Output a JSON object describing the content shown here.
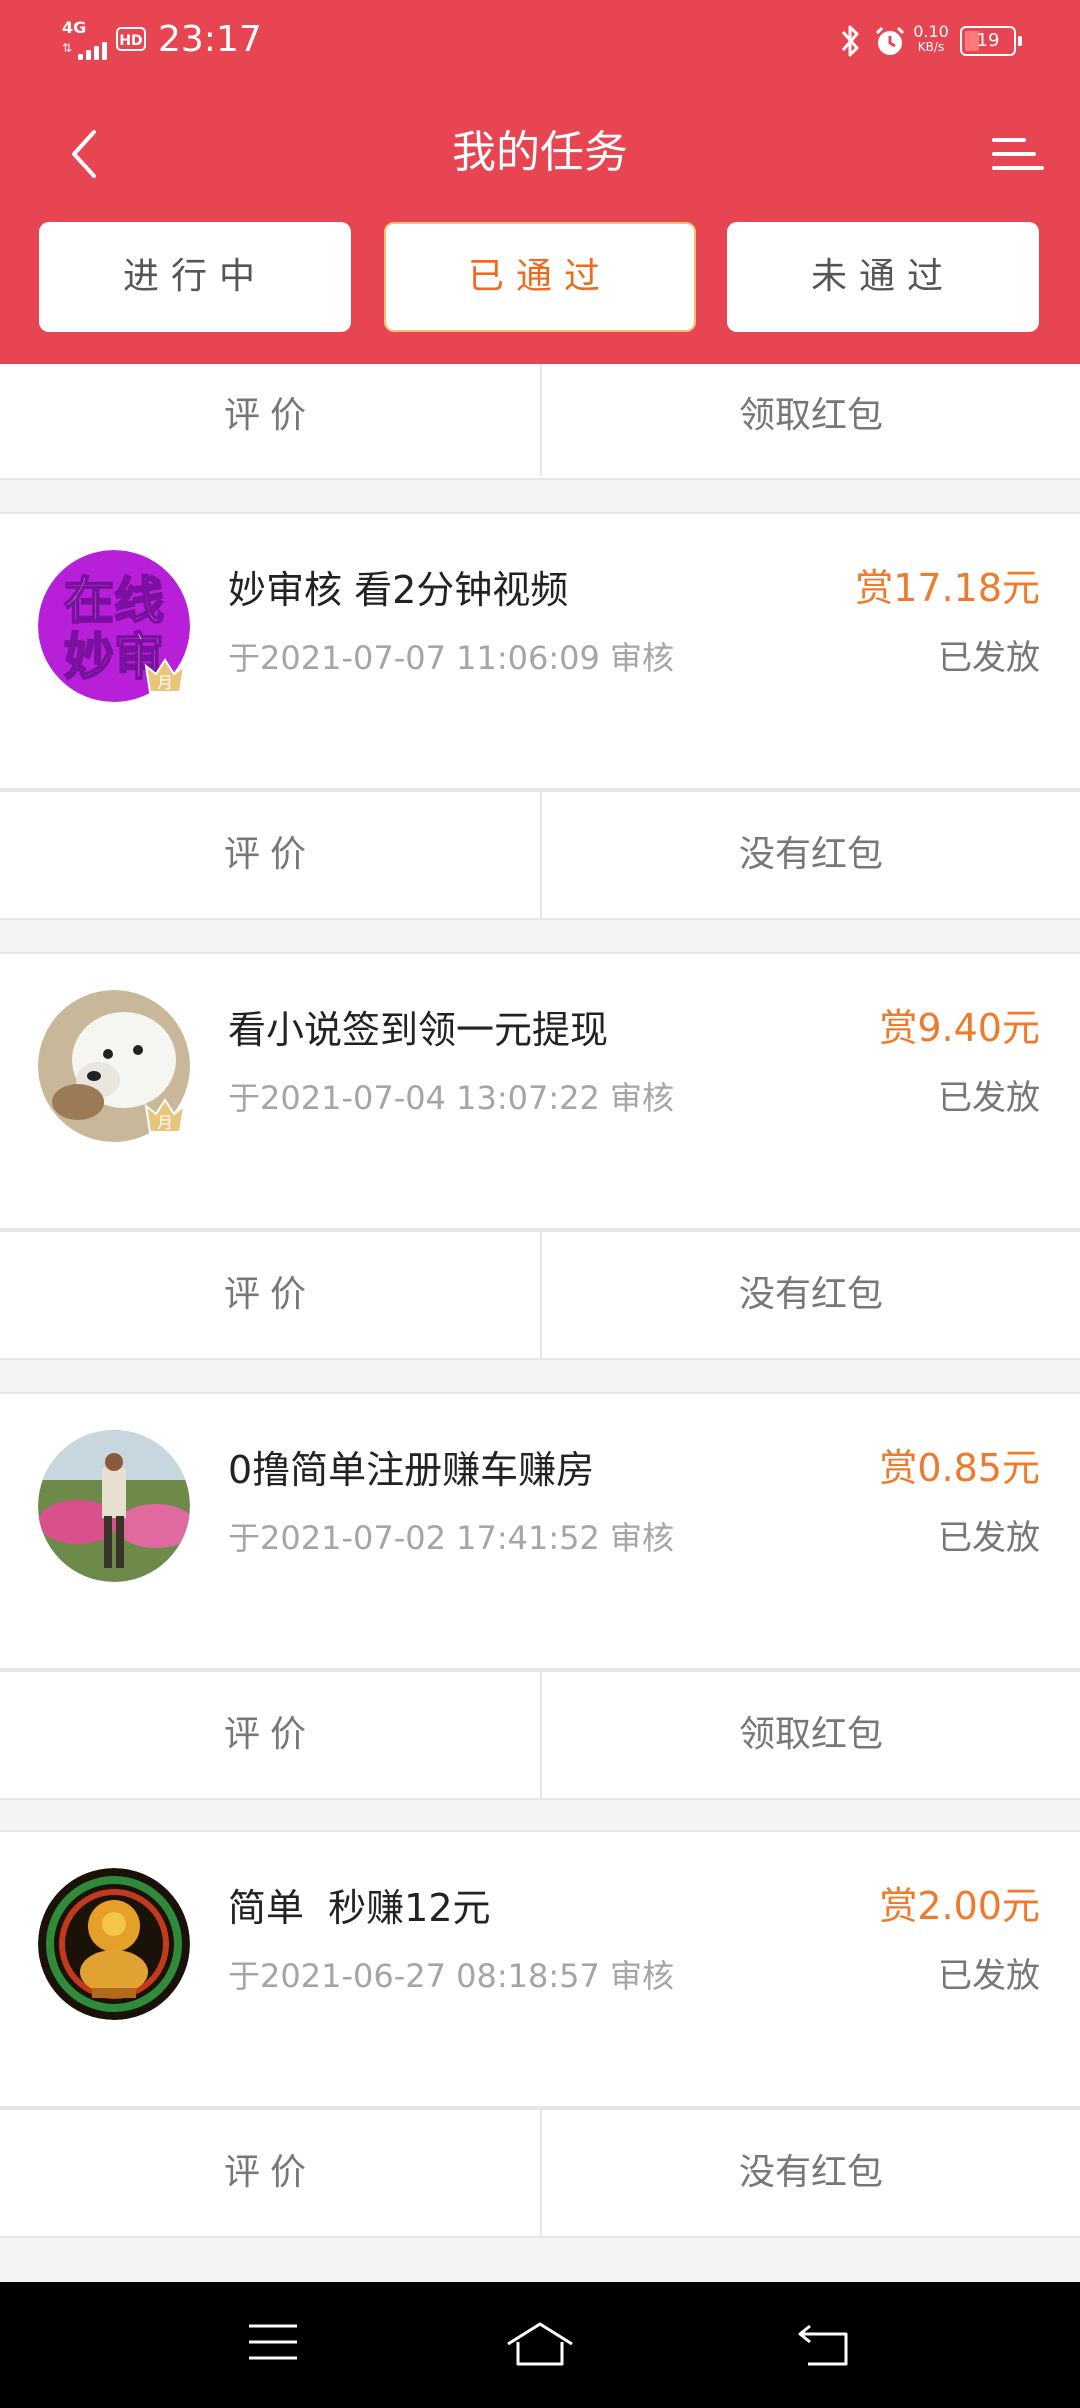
{
  "status_bar": {
    "network": "4G",
    "hd": "HD",
    "time": "23:17",
    "speed_value": "0.10",
    "speed_unit": "KB/s",
    "battery_level": "19"
  },
  "header": {
    "title": "我的任务",
    "tabs": [
      {
        "label": "进行中",
        "active": false
      },
      {
        "label": "已通过",
        "active": true
      },
      {
        "label": "未通过",
        "active": false
      }
    ]
  },
  "partial_row": {
    "left": "评价",
    "right": "领取红包"
  },
  "tasks": [
    {
      "avatar_text": "在线妙审",
      "title": "妙审核 看2分钟视频",
      "date": "于2021-07-07 11:06:09 审核",
      "reward": "赏17.18元",
      "status": "已发放",
      "action_left": "评价",
      "action_right": "没有红包"
    },
    {
      "title": "看小说签到领一元提现",
      "date": "于2021-07-04 13:07:22 审核",
      "reward": "赏9.40元",
      "status": "已发放",
      "action_left": "评价",
      "action_right": "没有红包"
    },
    {
      "title": "0撸简单注册赚车赚房",
      "date": "于2021-07-02 17:41:52 审核",
      "reward": "赏0.85元",
      "status": "已发放",
      "action_left": "评价",
      "action_right": "领取红包"
    },
    {
      "title": "简单  秒赚12元",
      "date": "于2021-06-27 08:18:57 审核",
      "reward": "赏2.00元",
      "status": "已发放",
      "action_left": "评价",
      "action_right": "没有红包"
    }
  ],
  "badge_text": "月",
  "colors": {
    "header_bg": "#e84552",
    "reward": "#f07a2c",
    "active_tab_text": "#f06a1e"
  }
}
